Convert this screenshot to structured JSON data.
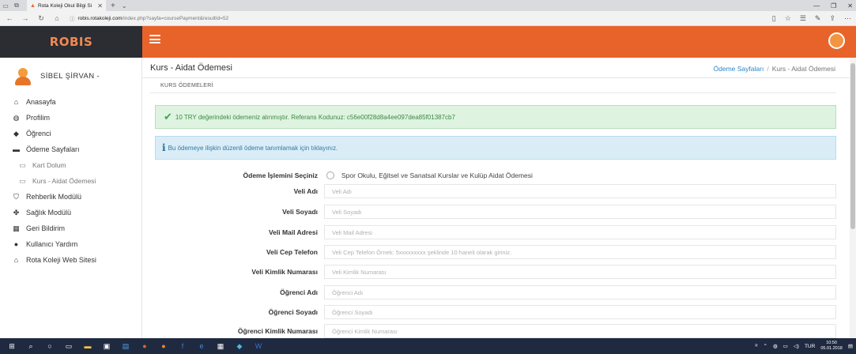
{
  "browser": {
    "tab_title": "Rota Koleji Okul Bilgi Si",
    "url_host": "robis.rotakoleji.com",
    "url_path": "/index.php?sayfa=coursePayment&resultId=52"
  },
  "app": {
    "logo": "ROBIS"
  },
  "sidebar": {
    "user_name": "SİBEL ŞİRVAN -",
    "items": [
      {
        "label": "Anasayfa",
        "icon": "home-icon"
      },
      {
        "label": "Profilim",
        "icon": "user-circle-icon"
      },
      {
        "label": "Öğrenci",
        "icon": "graduation-cap-icon"
      },
      {
        "label": "Ödeme Sayfaları",
        "icon": "credit-card-icon"
      },
      {
        "label": "Kart Dolum",
        "icon": "card-icon",
        "sub": true
      },
      {
        "label": "Kurs - Aidat Ödemesi",
        "icon": "card-icon",
        "sub": true
      },
      {
        "label": "Rehberlik Modülü",
        "icon": "shield-icon"
      },
      {
        "label": "Sağlık Modülü",
        "icon": "users-icon"
      },
      {
        "label": "Geri Bildirim",
        "icon": "feedback-icon"
      },
      {
        "label": "Kullanıcı Yardım",
        "icon": "question-icon"
      },
      {
        "label": "Rota Koleji Web Sitesi",
        "icon": "home-icon"
      }
    ]
  },
  "page": {
    "title": "Kurs - Aidat Ödemesi",
    "breadcrumb_link": "Ödeme Sayfaları",
    "breadcrumb_sep": "/",
    "breadcrumb_current": "Kurs - Aidat Ödemesi",
    "section_title": "KURS ÖDEMELERİ",
    "success_msg": "10 TRY değerindeki ödemeniz alınmıştır. Referans Kodunuz: c56e00f28d8a4ee097dea85f01387cb7",
    "info_msg": "Bu ödemeye ilişkin düzenli ödeme tanımlamak için tıklayınız."
  },
  "form": {
    "payment_label": "Ödeme İşlemini Seçiniz",
    "payment_option": "Spor Okulu, Eğitsel ve Sanatsal Kurslar ve Kulüp Aidat Ödemesi",
    "fields": [
      {
        "label": "Veli Adı",
        "placeholder": "Veli Adı"
      },
      {
        "label": "Veli Soyadı",
        "placeholder": "Veli Soyadı"
      },
      {
        "label": "Veli Mail Adresi",
        "placeholder": "Veli Mail Adresi"
      },
      {
        "label": "Veli Cep Telefon",
        "placeholder": "Veli Cep Telefon Örnek: 5xxxxxxxxx şeklinde 10 haneli olarak giriniz."
      },
      {
        "label": "Veli Kimlik Numarası",
        "placeholder": "Veli Kimlik Numarası"
      },
      {
        "label": "Öğrenci Adı",
        "placeholder": "Öğrenci Adı"
      },
      {
        "label": "Öğrenci Soyadı",
        "placeholder": "Öğrenci Soyadı"
      },
      {
        "label": "Öğrenci Kimlik Numarası",
        "placeholder": "Öğrenci Kimlik Numarası"
      }
    ]
  },
  "taskbar": {
    "lang": "TUR",
    "time": "10:50",
    "date": "05.01.2018"
  },
  "colors": {
    "accent": "#e8632a",
    "sidebar_dark": "#2c2d32",
    "success_bg": "#dff3e1",
    "info_bg": "#daedf6"
  }
}
